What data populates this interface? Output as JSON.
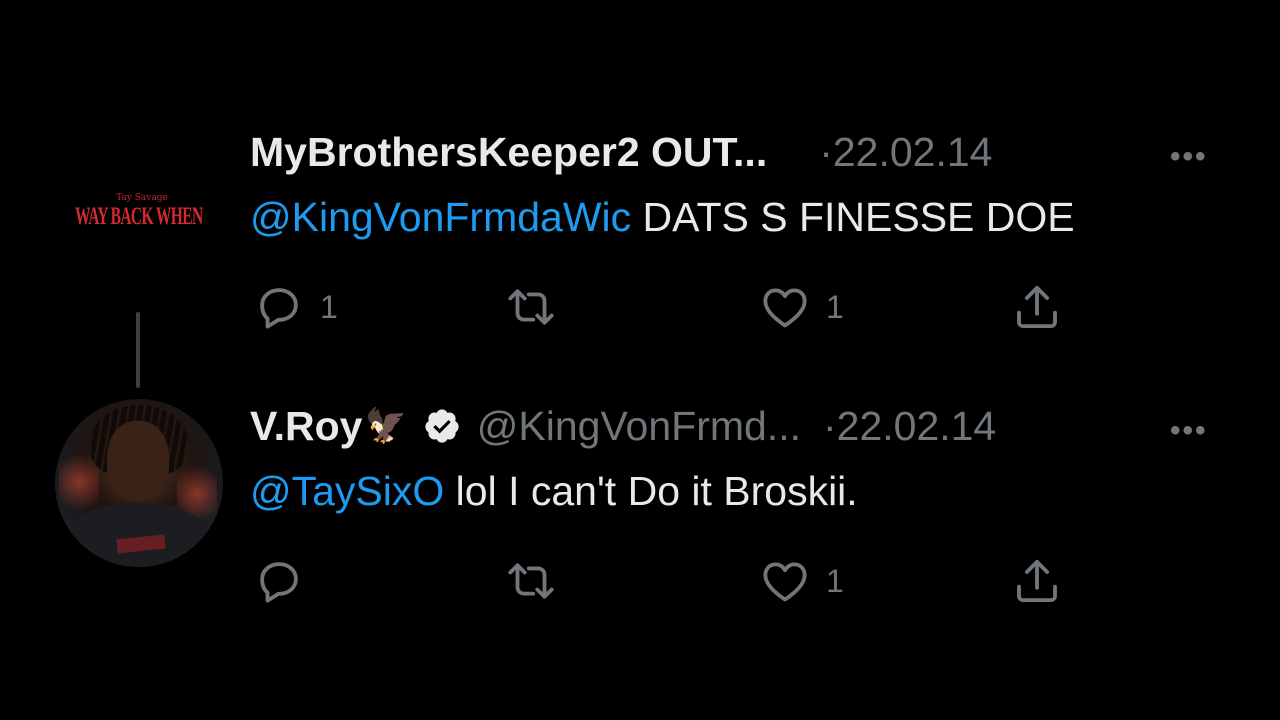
{
  "tweets": [
    {
      "author_name": "MyBrothersKeeper2 OUT...",
      "handle": "",
      "date": "22.02.14",
      "avatar_logo": {
        "small_text": "Tay Savage",
        "main_text": "WAY BACK WHEN"
      },
      "mention": "@KingVonFrmdaWic",
      "body": " DATS S FINESSE DOE",
      "reply_count": "1",
      "retweet_count": "",
      "like_count": "1"
    },
    {
      "author_name": "V.Roy",
      "name_emoji": "🦅",
      "verified": true,
      "handle": "@KingVonFrmd...",
      "date": "22.02.14",
      "mention": "@TaySixO",
      "body": " lol I can't Do it Broskii.",
      "reply_count": "",
      "retweet_count": "",
      "like_count": "1"
    }
  ],
  "separator": "·",
  "more_label": "•••",
  "colors": {
    "background": "#000000",
    "text": "#e7e9ea",
    "muted": "#71767b",
    "link": "#1d9bf0",
    "logo_red": "#d32a2f"
  },
  "icons": {
    "reply": "reply-icon",
    "retweet": "retweet-icon",
    "like": "heart-icon",
    "share": "share-icon",
    "more": "more-icon",
    "verified": "verified-badge-icon"
  }
}
